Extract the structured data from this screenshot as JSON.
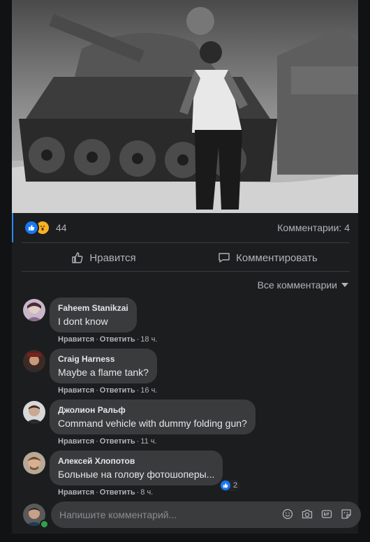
{
  "post": {
    "reaction_count": "44",
    "reaction_types": [
      "like-icon",
      "wow-icon"
    ],
    "comments_count": "Комментарии: 4"
  },
  "actions": {
    "like": "Нравится",
    "comment": "Комментировать"
  },
  "sort": {
    "label": "Все комментарии"
  },
  "meta_labels": {
    "like": "Нравится",
    "reply": "Ответить"
  },
  "comments": [
    {
      "author": "Faheem Stanikzai",
      "text": "I dont know",
      "time": "18 ч."
    },
    {
      "author": "Craig Harness",
      "text": "Maybe a flame tank?",
      "time": "16 ч."
    },
    {
      "author": "Джолион Ральф",
      "text": "Command vehicle with dummy folding gun?",
      "time": "11 ч."
    },
    {
      "author": "Алексей Хлопотов",
      "text": "Больные на голову фотошоперы...",
      "time": "8 ч.",
      "reaction_count": "2"
    }
  ],
  "composer": {
    "placeholder": "Напишите комментарий..."
  },
  "colors": {
    "accent": "#2d88ff",
    "like_blue": "#1877f2",
    "online": "#31a24c"
  }
}
